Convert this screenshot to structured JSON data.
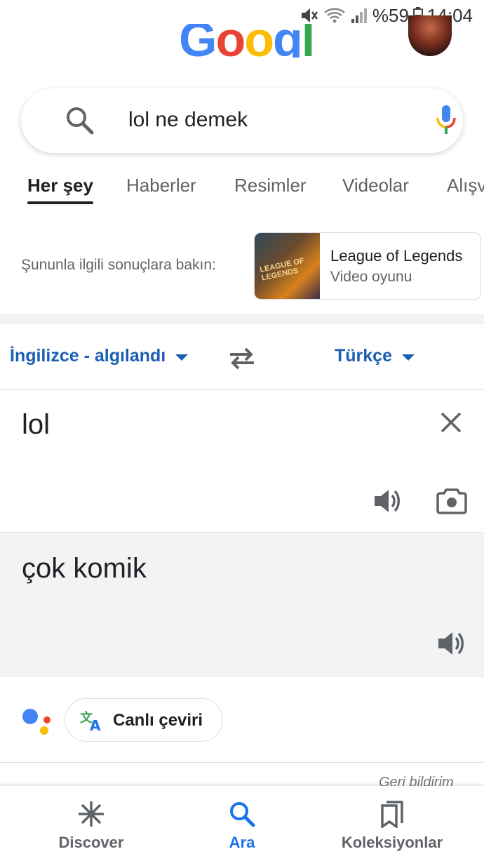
{
  "status_bar": {
    "battery": "%59",
    "time": "14:04"
  },
  "header": {
    "logo": "Google"
  },
  "search": {
    "query": "lol ne demek"
  },
  "tabs": [
    {
      "label": "Her şey",
      "active": true
    },
    {
      "label": "Haberler",
      "active": false
    },
    {
      "label": "Resimler",
      "active": false
    },
    {
      "label": "Videolar",
      "active": false
    },
    {
      "label": "Alışv",
      "active": false
    }
  ],
  "related": {
    "prompt": "Şununla ilgili sonuçlara bakın:",
    "card_title": "League of Legends",
    "card_subtitle": "Video oyunu",
    "thumb_text": "LEAGUE OF LEGENDS"
  },
  "translate": {
    "source_lang": "İngilizce - algılandı",
    "target_lang": "Türkçe",
    "source_text": "lol",
    "target_text": "çok komik",
    "live_translate_label": "Canlı çeviri",
    "feedback": "Geri bildirim"
  },
  "bottom_nav": [
    {
      "label": "Discover",
      "icon": "asterisk-icon",
      "active": false
    },
    {
      "label": "Ara",
      "icon": "search-icon",
      "active": true
    },
    {
      "label": "Koleksiyonlar",
      "icon": "collections-icon",
      "active": false
    }
  ],
  "colors": {
    "accent_blue": "#1a73e8",
    "lang_blue": "#1a5fb4",
    "google_blue": "#4285f4",
    "google_red": "#ea4335",
    "google_yellow": "#fbbc05",
    "google_green": "#34a853"
  }
}
